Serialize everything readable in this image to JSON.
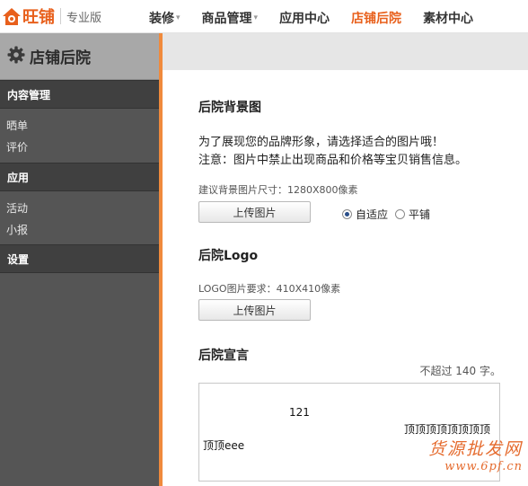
{
  "brand": {
    "name": "旺铺",
    "edition": "专业版"
  },
  "nav": {
    "items": [
      {
        "label": "装修",
        "caret": true,
        "active": false
      },
      {
        "label": "商品管理",
        "caret": true,
        "active": false
      },
      {
        "label": "应用中心",
        "caret": false,
        "active": false
      },
      {
        "label": "店铺后院",
        "caret": false,
        "active": true
      },
      {
        "label": "素材中心",
        "caret": false,
        "active": false
      }
    ],
    "caret_glyph": "▾"
  },
  "sidebar": {
    "title": "店铺后院",
    "sections": [
      {
        "label": "内容管理",
        "items": [
          "晒单",
          "评价"
        ]
      },
      {
        "label": "应用",
        "items": [
          "活动",
          "小报"
        ]
      },
      {
        "label": "设置",
        "items": []
      }
    ]
  },
  "background": {
    "title": "后院背景图",
    "intro": "为了展现您的品牌形象，请选择适合的图片哦！",
    "notice": "注意：图片中禁止出现商品和价格等宝贝销售信息。",
    "size_hint": "建议背景图片尺寸：1280X800像素",
    "upload_label": "上传图片",
    "options": [
      {
        "label": "自适应",
        "checked": true
      },
      {
        "label": "平铺",
        "checked": false
      }
    ]
  },
  "logo": {
    "title": "后院Logo",
    "size_hint": "LOGO图片要求：410X410像素",
    "upload_label": "上传图片"
  },
  "manifesto": {
    "title": "后院宣言",
    "limit": "不超过 140 字。",
    "lines": [
      "121",
      "顶顶顶顶顶顶顶顶",
      "顶顶eee"
    ]
  },
  "watermark": {
    "line1": "货源批发网",
    "line2": "www.6pf.cn"
  },
  "colors": {
    "accent": "#e8601c",
    "sidebar": "#555555",
    "sidebar_header": "#a8a8a8",
    "separator": "#f08a3c"
  },
  "icons": {
    "brand": "house-logo-icon",
    "sidebar_title": "gear-icon",
    "radio": "radio-icon"
  }
}
